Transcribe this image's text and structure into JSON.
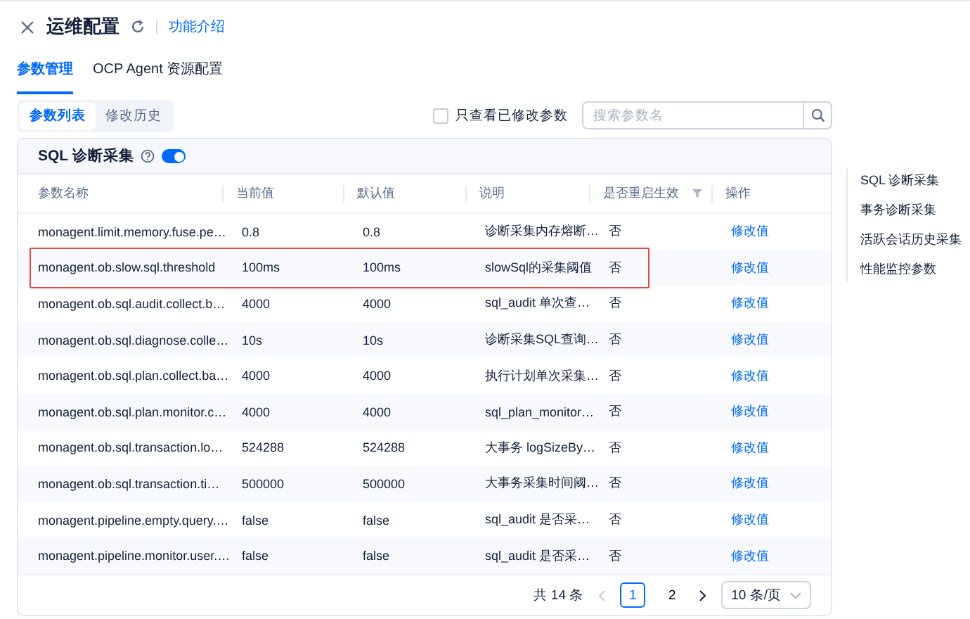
{
  "header": {
    "title": "运维配置",
    "link": "功能介绍"
  },
  "tabs": [
    {
      "label": "参数管理",
      "selected": true
    },
    {
      "label": "OCP Agent 资源配置",
      "selected": false
    }
  ],
  "subtabs": [
    {
      "label": "参数列表",
      "selected": true
    },
    {
      "label": "修改历史",
      "selected": false
    }
  ],
  "filter": {
    "label": "只查看已修改参数",
    "checked": false
  },
  "search": {
    "placeholder": "搜索参数名"
  },
  "section": {
    "title": "SQL 诊断采集",
    "enabled": true
  },
  "table": {
    "columns": [
      {
        "label": "参数名称",
        "filter": false
      },
      {
        "label": "当前值",
        "filter": false
      },
      {
        "label": "默认值",
        "filter": false
      },
      {
        "label": "说明",
        "filter": false
      },
      {
        "label": "是否重启生效",
        "filter": true
      },
      {
        "label": "操作",
        "filter": false
      }
    ],
    "rows": [
      {
        "name": "monagent.limit.memory.fuse.pe…",
        "current": "0.8",
        "default": "0.8",
        "description": "诊断采集内存熔断…",
        "restart": "否",
        "action": "修改值",
        "highlighted": false
      },
      {
        "name": "monagent.ob.slow.sql.threshold",
        "current": "100ms",
        "default": "100ms",
        "description": "slowSql的采集阈值",
        "restart": "否",
        "action": "修改值",
        "highlighted": true
      },
      {
        "name": "monagent.ob.sql.audit.collect.b…",
        "current": "4000",
        "default": "4000",
        "description": "sql_audit 单次查…",
        "restart": "否",
        "action": "修改值",
        "highlighted": false
      },
      {
        "name": "monagent.ob.sql.diagnose.colle…",
        "current": "10s",
        "default": "10s",
        "description": "诊断采集SQL查询…",
        "restart": "否",
        "action": "修改值",
        "highlighted": false
      },
      {
        "name": "monagent.ob.sql.plan.collect.ba…",
        "current": "4000",
        "default": "4000",
        "description": "执行计划单次采集…",
        "restart": "否",
        "action": "修改值",
        "highlighted": false
      },
      {
        "name": "monagent.ob.sql.plan.monitor.c…",
        "current": "4000",
        "default": "4000",
        "description": "sql_plan_monitor…",
        "restart": "否",
        "action": "修改值",
        "highlighted": false
      },
      {
        "name": "monagent.ob.sql.transaction.lo…",
        "current": "524288",
        "default": "524288",
        "description": "大事务 logSizeBy…",
        "restart": "否",
        "action": "修改值",
        "highlighted": false
      },
      {
        "name": "monagent.ob.sql.transaction.ti…",
        "current": "500000",
        "default": "500000",
        "description": "大事务采集时间阈…",
        "restart": "否",
        "action": "修改值",
        "highlighted": false
      },
      {
        "name": "monagent.pipeline.empty.query.…",
        "current": "false",
        "default": "false",
        "description": "sql_audit 是否采…",
        "restart": "否",
        "action": "修改值",
        "highlighted": false
      },
      {
        "name": "monagent.pipeline.monitor.user.…",
        "current": "false",
        "default": "false",
        "description": "sql_audit 是否采…",
        "restart": "否",
        "action": "修改值",
        "highlighted": false
      }
    ]
  },
  "pagination": {
    "total": "共 14 条",
    "pages": [
      {
        "label": "1",
        "selected": true
      },
      {
        "label": "2",
        "selected": false
      }
    ],
    "page_size": "10 条/页"
  },
  "side_nav": [
    {
      "label": "SQL 诊断采集"
    },
    {
      "label": "事务诊断采集"
    },
    {
      "label": "活跃会话历史采集"
    },
    {
      "label": "性能监控参数"
    }
  ]
}
